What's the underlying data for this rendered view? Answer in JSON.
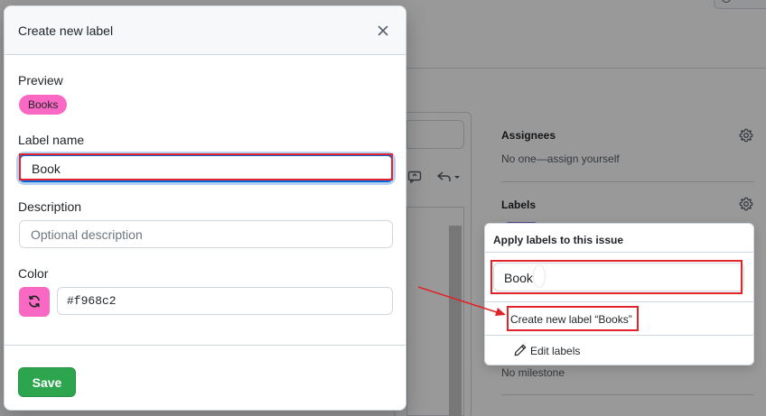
{
  "modal": {
    "title": "Create new label",
    "preview_label": "Preview",
    "preview_badge": "Books",
    "name_label": "Label name",
    "name_value": "Book",
    "description_label": "Description",
    "description_placeholder": "Optional description",
    "description_value": "",
    "color_label": "Color",
    "color_value": "#f968c2",
    "save_label": "Save"
  },
  "sidebar": {
    "assignees_title": "Assignees",
    "assignees_text": "No one—assign yourself",
    "labels_title": "Labels",
    "milestone_text": "No milestone"
  },
  "labels_dropdown": {
    "header": "Apply labels to this issue",
    "filter_value": "Book",
    "create_item": "Create new label “Books”",
    "edit_item": "Edit labels"
  },
  "icons": {
    "close": "x-icon",
    "refresh": "sync-icon",
    "gear": "gear-icon",
    "pencil": "pencil-icon"
  },
  "colors": {
    "label_color": "#f968c2",
    "save_button": "#2da44e",
    "annotation": "#e0242a",
    "focus": "#0969da"
  }
}
